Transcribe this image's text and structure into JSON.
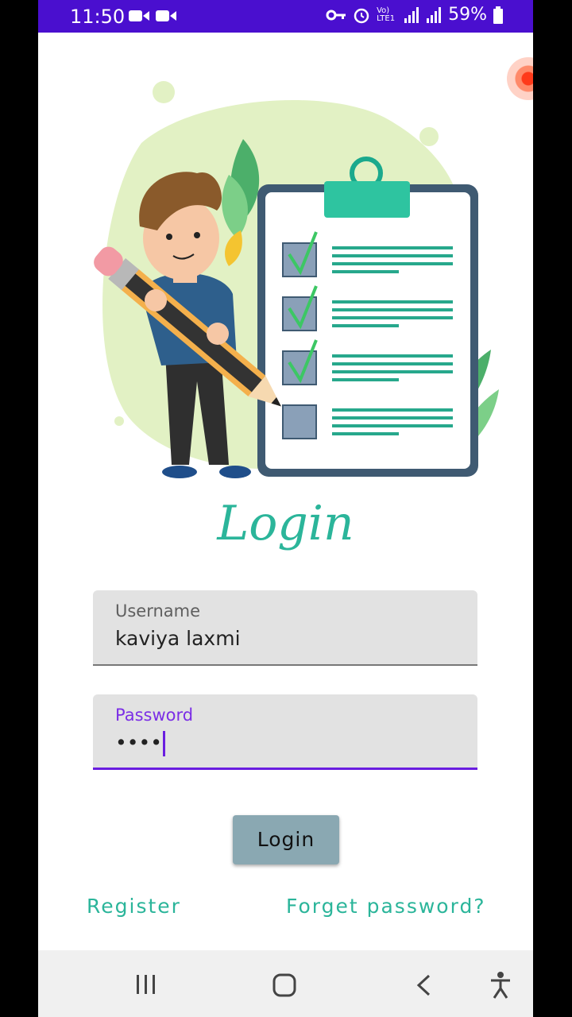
{
  "status_bar": {
    "time": "11:50",
    "battery": "59%",
    "network": "Vo) LTE1"
  },
  "screen": {
    "title": "Login"
  },
  "form": {
    "username_label": "Username",
    "username_value": "kaviya laxmi",
    "password_label": "Password",
    "password_value": "••••"
  },
  "actions": {
    "login": "Login",
    "register": "Register",
    "forgot": "Forget password?"
  },
  "colors": {
    "status_bar": "#4a0fcf",
    "accent": "#2bb59a",
    "focus": "#6a1de0",
    "button": "#8aa8b2"
  },
  "nav": {
    "icons": [
      "recent-apps-icon",
      "home-icon",
      "back-icon",
      "accessibility-icon"
    ]
  }
}
